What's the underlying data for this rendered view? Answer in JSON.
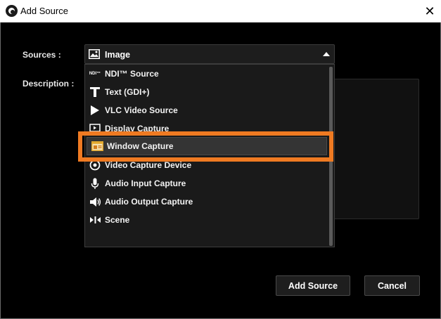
{
  "window": {
    "title": "Add Source",
    "close_label": "✕"
  },
  "form": {
    "sources_label": "Sources :",
    "description_label": "Description :",
    "selected_source": "Image",
    "selected_icon": "image-icon"
  },
  "dropdown": {
    "items": [
      {
        "label": "NDI™ Source",
        "icon": "ndi-icon"
      },
      {
        "label": "Text (GDI+)",
        "icon": "text-icon"
      },
      {
        "label": "VLC Video Source",
        "icon": "play-icon"
      },
      {
        "label": "Display Capture",
        "icon": "display-icon"
      },
      {
        "label": "Window Capture",
        "icon": "window-icon",
        "selected": true
      },
      {
        "label": "Video Capture Device",
        "icon": "camera-icon"
      },
      {
        "label": "Audio Input Capture",
        "icon": "microphone-icon"
      },
      {
        "label": "Audio Output Capture",
        "icon": "speaker-icon"
      },
      {
        "label": "Scene",
        "icon": "scene-icon"
      }
    ],
    "ndi_badge": "NDI™"
  },
  "buttons": {
    "add_label": "Add Source",
    "cancel_label": "Cancel"
  },
  "colors": {
    "highlight": "#ef7a22",
    "background": "#000000"
  }
}
